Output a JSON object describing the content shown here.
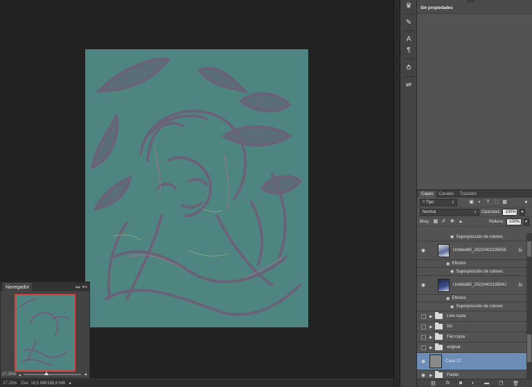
{
  "navigator": {
    "title": "Navegador",
    "zoom": "27,25%",
    "collapse_glyph": "◂◂",
    "menu_glyph": "▾≡"
  },
  "statusbar": {
    "zoom": "27,25%",
    "doc_info": "Doc: 18,5 MB/158,8 MB"
  },
  "properties": {
    "title": "Sin propiedades"
  },
  "layers_panel": {
    "tabs": [
      "Capas",
      "Canales",
      "Trazados"
    ],
    "kind_filter": "Tipo",
    "blend_mode": "Normal",
    "opacity_label": "Opacidad:",
    "opacity_value": "100%",
    "lock_label": "Bloq.:",
    "fill_label": "Relleno:",
    "fill_value": "100%",
    "layers": [
      {
        "type": "effect",
        "name": "Superposición de colores"
      },
      {
        "type": "pixel",
        "name": "Untitled80_20220402185055",
        "visible": true,
        "has_fx": true
      },
      {
        "type": "effects-label",
        "name": "Efectos"
      },
      {
        "type": "effect",
        "name": "Superposición de colores"
      },
      {
        "type": "pixel",
        "name": "Untitled80_20220402185042",
        "visible": true,
        "has_fx": true
      },
      {
        "type": "effects-label",
        "name": "Efectos"
      },
      {
        "type": "effect",
        "name": "Superposición de colores"
      },
      {
        "type": "group",
        "name": "Line copia",
        "visible": false
      },
      {
        "type": "group",
        "name": "Iris",
        "visible": false
      },
      {
        "type": "group",
        "name": "Flat copia",
        "visible": false
      },
      {
        "type": "group",
        "name": "original",
        "visible": false
      },
      {
        "type": "pixel-plain",
        "name": "Capa 22",
        "visible": true,
        "selected": true
      },
      {
        "type": "group",
        "name": "Fondo",
        "visible": true
      }
    ]
  },
  "colors": {
    "canvas": "#4f8580",
    "artwork_lines": "#6f5c78",
    "selection": "#6b8db6",
    "nav_frame": "#d9443f"
  }
}
